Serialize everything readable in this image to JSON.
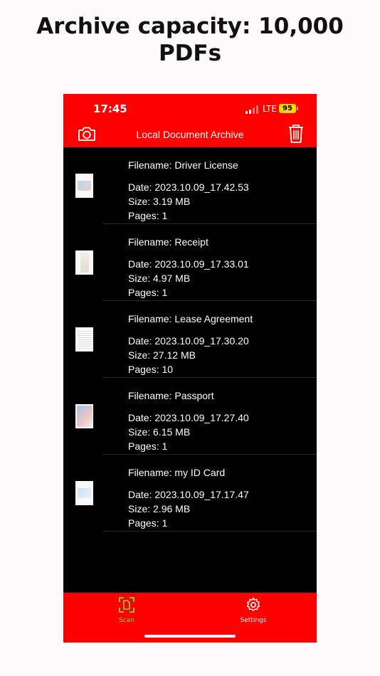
{
  "headline": {
    "line1": "Archive capacity: 10,000",
    "line2": "PDFs"
  },
  "status_bar": {
    "time": "17:45",
    "network": "LTE",
    "battery": "95"
  },
  "nav": {
    "title": "Local Document Archive",
    "left_icon": "camera-icon",
    "right_icon": "trash-icon"
  },
  "documents": [
    {
      "filename": "Filename: Driver License",
      "date": "Date: 2023.10.09_17.42.53",
      "size": "Size: 3.19 MB",
      "pages": "Pages: 1"
    },
    {
      "filename": "Filename: Receipt",
      "date": "Date: 2023.10.09_17.33.01",
      "size": "Size: 4.97 MB",
      "pages": "Pages: 1"
    },
    {
      "filename": "Filename: Lease Agreement",
      "date": "Date: 2023.10.09_17.30.20",
      "size": "Size: 27.12 MB",
      "pages": "Pages: 10"
    },
    {
      "filename": "Filename: Passport",
      "date": "Date: 2023.10.09_17.27.40",
      "size": "Size: 6.15 MB",
      "pages": "Pages: 1"
    },
    {
      "filename": "Filename: my ID Card",
      "date": "Date: 2023.10.09_17.17.47",
      "size": "Size: 2.96 MB",
      "pages": "Pages: 1"
    }
  ],
  "tabs": [
    {
      "label": "Scan",
      "icon": "scan-icon",
      "active": true
    },
    {
      "label": "Settings",
      "icon": "gear-icon",
      "active": false
    }
  ],
  "colors": {
    "brand": "#fe0000",
    "active_tab": "#7fd84a",
    "background": "#000000"
  }
}
